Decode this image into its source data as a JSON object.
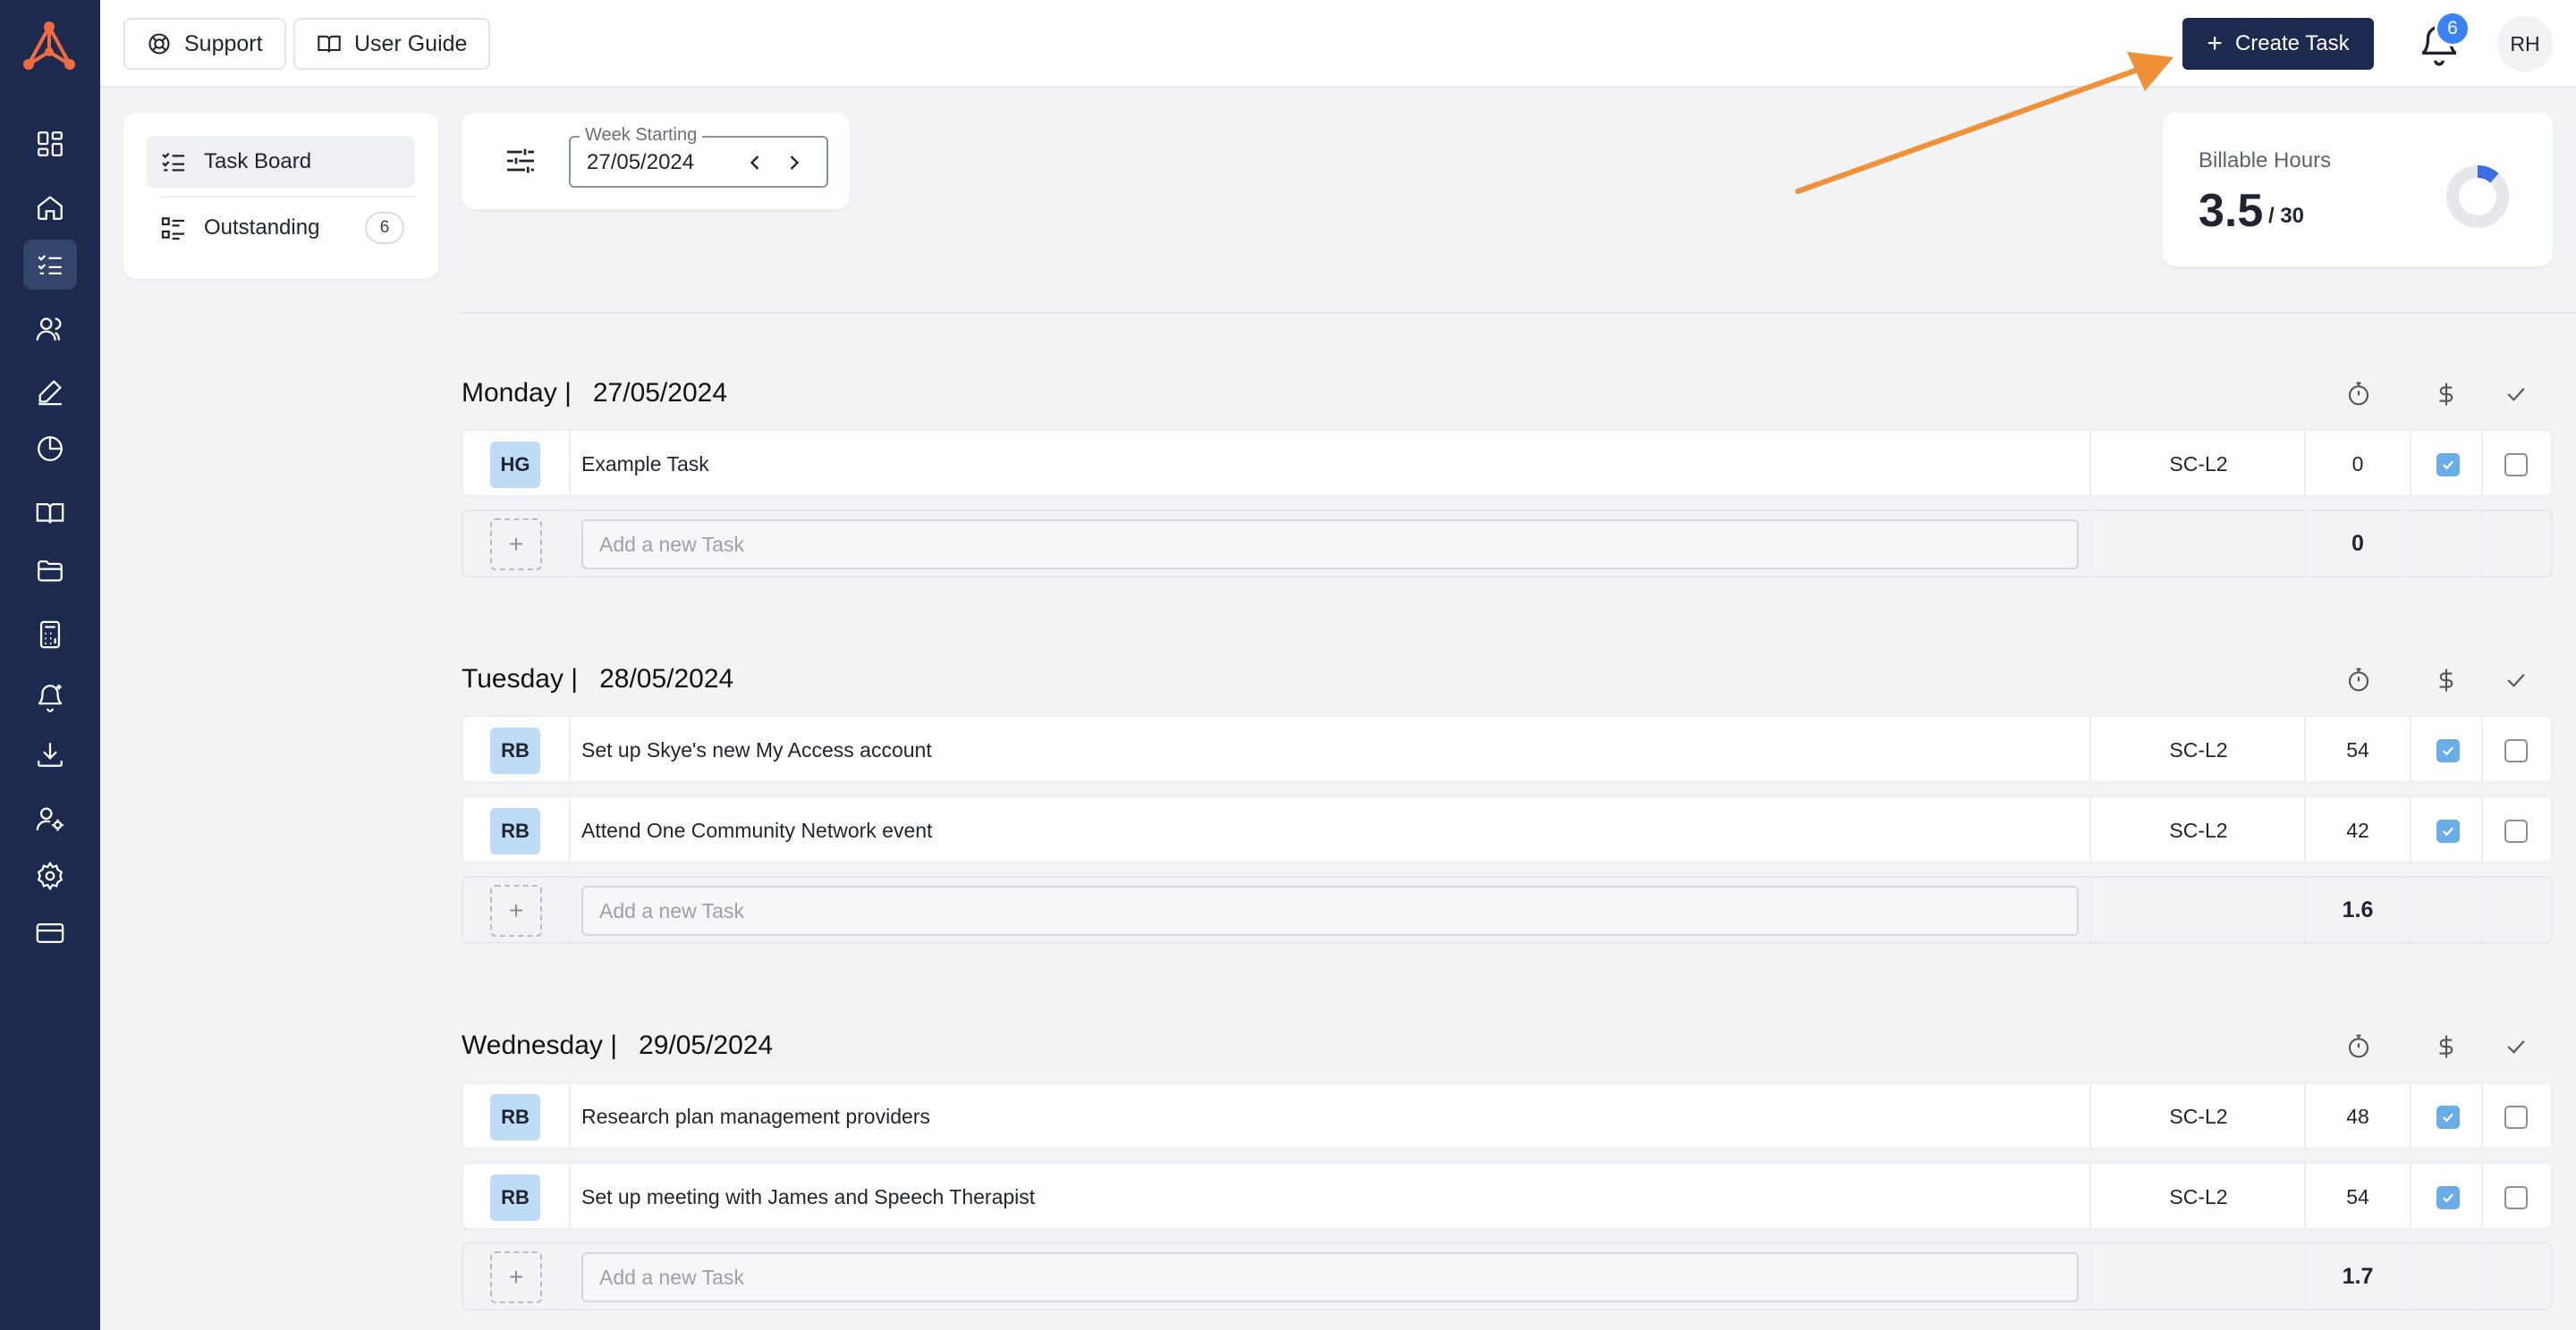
{
  "topbar": {
    "support_label": "Support",
    "user_guide_label": "User Guide",
    "create_task_label": "Create Task",
    "notification_count": "6",
    "user_initials": "RH"
  },
  "nav": {
    "items": [
      {
        "label": "Task Board",
        "active": true
      },
      {
        "label": "Outstanding",
        "count": "6"
      }
    ]
  },
  "filter": {
    "week_label": "Week Starting",
    "week_value": "27/05/2024"
  },
  "billable": {
    "label": "Billable Hours",
    "value": "3.5",
    "total": "/ 30",
    "fraction": 0.117
  },
  "days": [
    {
      "day": "Monday |",
      "date": "27/05/2024",
      "tasks": [
        {
          "initials": "HG",
          "name": "Example Task",
          "code": "SC-L2",
          "time": "0",
          "billable": true,
          "done": false
        }
      ],
      "add_placeholder": "Add a new Task",
      "total": "0"
    },
    {
      "day": "Tuesday |",
      "date": "28/05/2024",
      "tasks": [
        {
          "initials": "RB",
          "name": "Set up Skye's new My Access account",
          "code": "SC-L2",
          "time": "54",
          "billable": true,
          "done": false
        },
        {
          "initials": "RB",
          "name": "Attend One Community Network event",
          "code": "SC-L2",
          "time": "42",
          "billable": true,
          "done": false
        }
      ],
      "add_placeholder": "Add a new Task",
      "total": "1.6"
    },
    {
      "day": "Wednesday |",
      "date": "29/05/2024",
      "tasks": [
        {
          "initials": "RB",
          "name": "Research plan management providers",
          "code": "SC-L2",
          "time": "48",
          "billable": true,
          "done": false
        },
        {
          "initials": "RB",
          "name": "Set up meeting with James and Speech Therapist",
          "code": "SC-L2",
          "time": "54",
          "billable": true,
          "done": false
        }
      ],
      "add_placeholder": "Add a new Task",
      "total": "1.7"
    }
  ],
  "colors": {
    "sidebar": "#1b2a4e",
    "accent": "#3b82f6",
    "annotation_arrow": "#f0913a"
  }
}
